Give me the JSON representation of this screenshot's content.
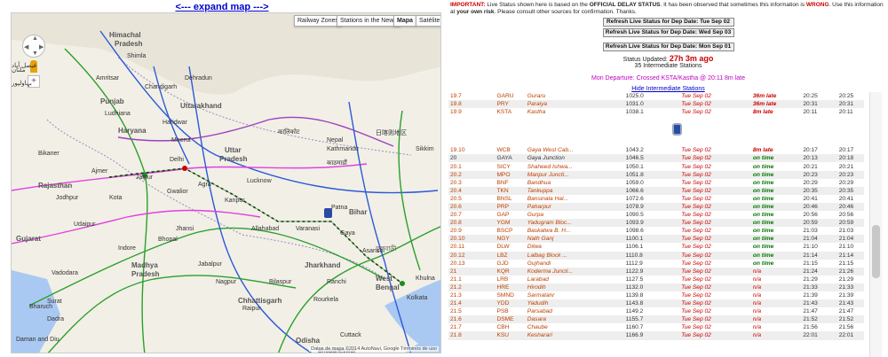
{
  "map": {
    "expand_label": "<--- expand map --->",
    "buttons": [
      "Railway Zones",
      "Stations in the News",
      "Mapa",
      "Satélite"
    ],
    "attribution": "Datos de mapa ©2014 AutoNavi, Google   Términos de uso",
    "labels": [
      {
        "t": "Himachal",
        "c": "state"
      },
      {
        "t": "Pradesh",
        "c": "state"
      },
      {
        "t": "Punjab",
        "c": "state"
      },
      {
        "t": "Uttarakhand",
        "c": "state"
      },
      {
        "t": "Haryana",
        "c": "state"
      },
      {
        "t": "Uttar",
        "c": "state"
      },
      {
        "t": "Pradesh",
        "c": "state"
      },
      {
        "t": "Rajasthan",
        "c": "state"
      },
      {
        "t": "Bihar",
        "c": "state"
      },
      {
        "t": "Madhya",
        "c": "state"
      },
      {
        "t": "Pradesh",
        "c": "state"
      },
      {
        "t": "Jharkhand",
        "c": "state"
      },
      {
        "t": "West",
        "c": "state"
      },
      {
        "t": "Bengal",
        "c": "state"
      },
      {
        "t": "Chhattisgarh",
        "c": "state"
      },
      {
        "t": "Odisha",
        "c": "state"
      },
      {
        "t": "Maharashtra",
        "c": "state"
      },
      {
        "t": "Gujarat",
        "c": "state"
      },
      {
        "t": "Delhi",
        "c": "city"
      },
      {
        "t": "Jaipur",
        "c": "city"
      },
      {
        "t": "Agra",
        "c": "city"
      },
      {
        "t": "Gwalior",
        "c": "city"
      },
      {
        "t": "Kanpur",
        "c": "city"
      },
      {
        "t": "Lucknow",
        "c": "city"
      },
      {
        "t": "Patna",
        "c": "city"
      },
      {
        "t": "Ranchi",
        "c": "city"
      },
      {
        "t": "Kolkata",
        "c": "city"
      },
      {
        "t": "Kathmandu",
        "c": "city"
      },
      {
        "t": "Sikkim",
        "c": "city"
      },
      {
        "t": "Jodhpur",
        "c": "city"
      },
      {
        "t": "Udaipur",
        "c": "city"
      },
      {
        "t": "Bikaner",
        "c": "city"
      },
      {
        "t": "Bhopal",
        "c": "city"
      },
      {
        "t": "Indore",
        "c": "city"
      },
      {
        "t": "Surat",
        "c": "city"
      },
      {
        "t": "Nagpur",
        "c": "city"
      },
      {
        "t": "Raipur",
        "c": "city"
      },
      {
        "t": "Khulna",
        "c": "city"
      },
      {
        "t": "Bhubaneswar",
        "c": "city"
      },
      {
        "t": "Daman and Diu",
        "c": "city"
      },
      {
        "t": "Dadra",
        "c": "city"
      },
      {
        "t": "Chandigarh",
        "c": "city"
      },
      {
        "t": "Ludhiana",
        "c": "city"
      },
      {
        "t": "Dehradun",
        "c": "city"
      },
      {
        "t": "Bharuch",
        "c": "city"
      },
      {
        "t": "Vadodara",
        "c": "city"
      },
      {
        "t": "Nepal",
        "c": "city"
      },
      {
        "t": "Allahabad",
        "c": "city"
      },
      {
        "t": "Varanasi",
        "c": "city"
      },
      {
        "t": "Gaya",
        "c": "city"
      },
      {
        "t": "Asansol",
        "c": "city"
      },
      {
        "t": "Jhansi",
        "c": "city"
      },
      {
        "t": "Jabalpur",
        "c": "city"
      },
      {
        "t": "Bilaspur",
        "c": "city"
      },
      {
        "t": "Rourkela",
        "c": "city"
      },
      {
        "t": "Cuttack",
        "c": "city"
      },
      {
        "t": "Ajmer",
        "c": "city"
      },
      {
        "t": "Kota",
        "c": "city"
      },
      {
        "t": "Haridwar",
        "c": "city"
      },
      {
        "t": "Meerut",
        "c": "city"
      },
      {
        "t": "Amritsar",
        "c": "city"
      },
      {
        "t": "Shimla",
        "c": "city"
      },
      {
        "t": "日喀则地区",
        "c": "city"
      },
      {
        "t": "कालिकोट",
        "c": "city"
      },
      {
        "t": "काठमाडौं",
        "c": "city"
      },
      {
        "t": "ফুলবাড়ী",
        "c": "city"
      },
      {
        "t": "بہاولپور",
        "c": "city"
      },
      {
        "t": "ملتان",
        "c": "city"
      },
      {
        "t": "فیصل آباد",
        "c": "city"
      }
    ]
  },
  "status": {
    "important": "IMPORTANT:",
    "text1": " Live Status shown here is based on the ",
    "official": "OFFICIAL DELAY STATUS",
    "text2": ". It has been observed that sometimes this information is ",
    "wrong": "WRONG",
    "text3": ". Use this information at ",
    "risk": "your own risk",
    "text4": ". Please consult other sources for confirmation. Thanks.",
    "btn1": "Refresh Live Status for Dep Date: Tue Sep 02",
    "btn2": "Refresh Live Status for Dep Date: Wed Sep 03",
    "btn3": "Refresh Live Status for Dep Date: Mon Sep 01",
    "updated_label": "Status Updated: ",
    "updated_ago": "27h 3m ago",
    "intermediate": "35 Intermediate Stations",
    "mon_departure": "Mon Departure: Crossed KSTA/Kastha @ 20:11 8m late",
    "hide_link": "Hide Intermediate Stations"
  },
  "rows_top": [
    [
      "19.7",
      "GARU",
      "Guraru",
      "1025.0",
      "Tue Sep 02",
      "36m late",
      "20:25",
      "20:25"
    ],
    [
      "19.8",
      "PRY",
      "Paraiya",
      "1031.0",
      "Tue Sep 02",
      "36m late",
      "20:31",
      "20:31"
    ],
    [
      "19.9",
      "KSTA",
      "Kastha",
      "1038.1",
      "Tue Sep 02",
      "8m late",
      "20:11",
      "20:11"
    ]
  ],
  "rows": [
    [
      "19.10",
      "WCB",
      "Gaya West Cab...",
      "1043.2",
      "Tue Sep 02",
      "8m late",
      "20:17",
      "20:17"
    ],
    [
      "20",
      "GAYA",
      "Gaya Junction",
      "1046.5",
      "Tue Sep 02",
      "on time",
      "20:13",
      "20:18"
    ],
    [
      "20.1",
      "SICY",
      "Shaheed Ishwa...",
      "1050.1",
      "Tue Sep 02",
      "on time",
      "20:21",
      "20:21"
    ],
    [
      "20.2",
      "MPO",
      "Manpur Juncti...",
      "1051.8",
      "Tue Sep 02",
      "on time",
      "20:23",
      "20:23"
    ],
    [
      "20.3",
      "BNF",
      "Bandhua",
      "1059.0",
      "Tue Sep 02",
      "on time",
      "20:29",
      "20:29"
    ],
    [
      "20.4",
      "TKN",
      "Tankuppa",
      "1066.6",
      "Tue Sep 02",
      "on time",
      "20:35",
      "20:35"
    ],
    [
      "20.5",
      "BNSL",
      "Bansinala Hal...",
      "1072.6",
      "Tue Sep 02",
      "on time",
      "20:41",
      "20:41"
    ],
    [
      "20.6",
      "PRP",
      "Paharpur",
      "1078.9",
      "Tue Sep 02",
      "on time",
      "20:46",
      "20:46"
    ],
    [
      "20.7",
      "GAP",
      "Gurpa",
      "1090.5",
      "Tue Sep 02",
      "on time",
      "20:56",
      "20:56"
    ],
    [
      "20.8",
      "YGM",
      "Yadugram Bloc...",
      "1093.9",
      "Tue Sep 02",
      "on time",
      "20:59",
      "20:59"
    ],
    [
      "20.9",
      "BSCP",
      "Baskatwa B. H...",
      "1098.6",
      "Tue Sep 02",
      "on time",
      "21:03",
      "21:03"
    ],
    [
      "20.10",
      "NGY",
      "Nath Ganj",
      "1100.1",
      "Tue Sep 02",
      "on time",
      "21:04",
      "21:04"
    ],
    [
      "20.11",
      "DLW",
      "Dilwa",
      "1106.1",
      "Tue Sep 02",
      "on time",
      "21:10",
      "21:10"
    ],
    [
      "20.12",
      "LBZ",
      "Lalbag Block ...",
      "1110.8",
      "Tue Sep 02",
      "on time",
      "21:14",
      "21:14"
    ],
    [
      "20.13",
      "GJD",
      "Gujhandi",
      "1112.9",
      "Tue Sep 02",
      "on time",
      "21:15",
      "21:15"
    ],
    [
      "21",
      "KQR",
      "Koderma Juncti...",
      "1122.9",
      "Tue Sep 02",
      "n/a",
      "21:24",
      "21:26"
    ],
    [
      "21.1",
      "LRB",
      "Larabad",
      "1127.5",
      "Tue Sep 02",
      "n/a",
      "21:29",
      "21:29"
    ],
    [
      "21.2",
      "HRE",
      "Hirodih",
      "1132.0",
      "Tue Sep 02",
      "n/a",
      "21:33",
      "21:33"
    ],
    [
      "21.3",
      "SMND",
      "Sarmatanr",
      "1139.8",
      "Tue Sep 02",
      "n/a",
      "21:39",
      "21:39"
    ],
    [
      "21.4",
      "YDD",
      "Yadudih",
      "1143.8",
      "Tue Sep 02",
      "n/a",
      "21:43",
      "21:43"
    ],
    [
      "21.5",
      "PSB",
      "Parsabad",
      "1149.2",
      "Tue Sep 02",
      "n/a",
      "21:47",
      "21:47"
    ],
    [
      "21.6",
      "DSME",
      "Dasara",
      "1155.7",
      "Tue Sep 02",
      "n/a",
      "21:52",
      "21:52"
    ],
    [
      "21.7",
      "CBH",
      "Chaube",
      "1160.7",
      "Tue Sep 02",
      "n/a",
      "21:56",
      "21:56"
    ],
    [
      "21.8",
      "KSU",
      "Kesharari",
      "1166.9",
      "Tue Sep 02",
      "n/a",
      "22:01",
      "22:01"
    ]
  ]
}
